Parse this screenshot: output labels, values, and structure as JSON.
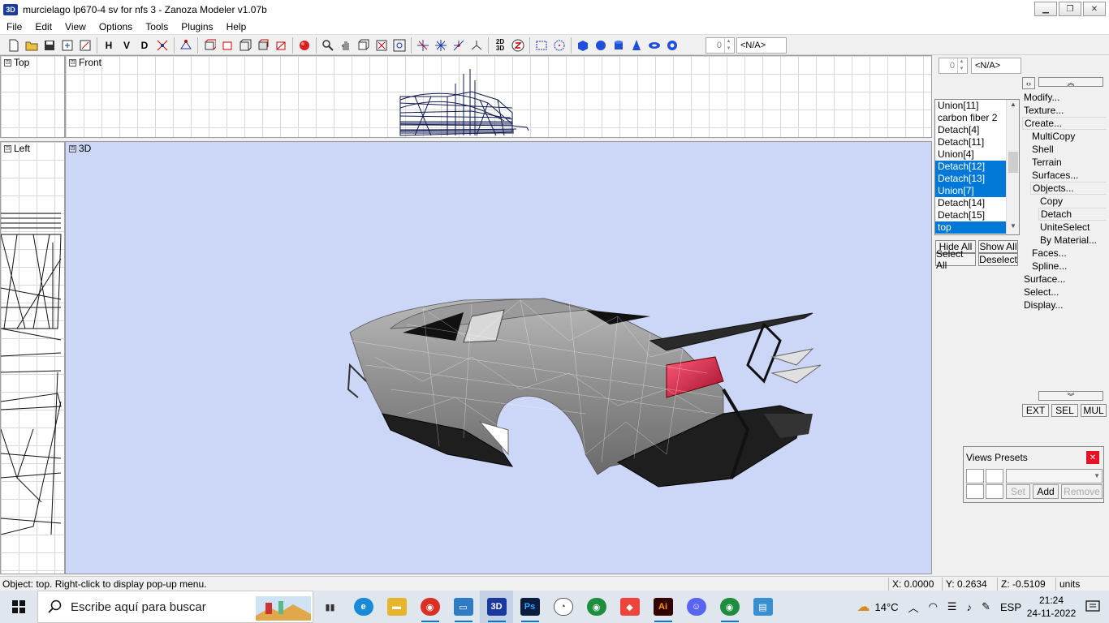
{
  "window": {
    "title": "murcielago lp670-4 sv for nfs 3 - Zanoza Modeler v1.07b",
    "icon_text": "3D"
  },
  "menu": [
    "File",
    "Edit",
    "View",
    "Options",
    "Tools",
    "Plugins",
    "Help"
  ],
  "toolbar": {
    "h_label": "H",
    "v_label": "V",
    "d_label": "D",
    "spin_value": "0",
    "na_value": "<N/A>"
  },
  "viewports": {
    "top": "Top",
    "front": "Front",
    "left": "Left",
    "threeD": "3D"
  },
  "right_panel": {
    "spin_value": "0",
    "na_value": "<N/A>",
    "objects": [
      {
        "label": "Union[11]",
        "selected": false
      },
      {
        "label": "carbon fiber 2",
        "selected": false
      },
      {
        "label": "Detach[4]",
        "selected": false
      },
      {
        "label": "Detach[11]",
        "selected": false
      },
      {
        "label": "Union[4]",
        "selected": false
      },
      {
        "label": "Detach[12]",
        "selected": true
      },
      {
        "label": "Detach[13]",
        "selected": true
      },
      {
        "label": "Union[7]",
        "selected": true
      },
      {
        "label": "Detach[14]",
        "selected": false
      },
      {
        "label": "Detach[15]",
        "selected": false
      },
      {
        "label": "top",
        "selected": true
      }
    ],
    "buttons": {
      "hide_all": "Hide All",
      "show_all": "Show All",
      "select_all": "Select All",
      "deselect": "Deselect"
    },
    "tree": {
      "modify": "Modify...",
      "texture": "Texture...",
      "create": "Create...",
      "multicopy": "MultiCopy",
      "shell": "Shell",
      "terrain": "Terrain",
      "surfaces": "Surfaces...",
      "objects": "Objects...",
      "copy": "Copy",
      "detach": "Detach",
      "uniteselect": "UniteSelect",
      "by_material": "By Material...",
      "faces": "Faces...",
      "spline": "Spline...",
      "surface": "Surface...",
      "select": "Select...",
      "display": "Display..."
    },
    "mode_buttons": {
      "ext": "EXT",
      "sel": "SEL",
      "mul": "MUL"
    }
  },
  "views_presets": {
    "title": "Views Presets",
    "set": "Set",
    "add": "Add",
    "remove": "Remove"
  },
  "status": {
    "message": "Object: top. Right-click to display pop-up menu.",
    "x": "X: 0.0000",
    "y": "Y: 0.2634",
    "z": "Z: -0.5109",
    "units": "units"
  },
  "taskbar": {
    "search_placeholder": "Escribe aquí para buscar",
    "temperature": "14°C",
    "language": "ESP",
    "time": "21:24",
    "date": "24-11-2022",
    "apps": [
      {
        "name": "task-view",
        "glyph": "▮▮",
        "color": "#333333"
      },
      {
        "name": "edge",
        "glyph": "e",
        "color": "#1b8ad6"
      },
      {
        "name": "file-explorer",
        "glyph": "▬",
        "color": "#e7b52c"
      },
      {
        "name": "chrome-profile",
        "glyph": "◉",
        "color": "#d93025"
      },
      {
        "name": "remote-desktop",
        "glyph": "▭",
        "color": "#2f7cc2"
      },
      {
        "name": "zanoza-modeler",
        "glyph": "3D",
        "color": "#1a3aa0"
      },
      {
        "name": "photoshop",
        "glyph": "Ps",
        "color": "#0a1d3f"
      },
      {
        "name": "app-swirl",
        "glyph": "◔",
        "color": "#555555"
      },
      {
        "name": "chrome",
        "glyph": "◉",
        "color": "#1e8e3e"
      },
      {
        "name": "anydesk",
        "glyph": "◆",
        "color": "#ef443b"
      },
      {
        "name": "illustrator",
        "glyph": "Ai",
        "color": "#330000"
      },
      {
        "name": "discord",
        "glyph": "☺",
        "color": "#5865f2"
      },
      {
        "name": "chrome-ak",
        "glyph": "◉",
        "color": "#1e8e3e"
      },
      {
        "name": "notepad",
        "glyph": "▤",
        "color": "#3a8fd0"
      }
    ]
  }
}
